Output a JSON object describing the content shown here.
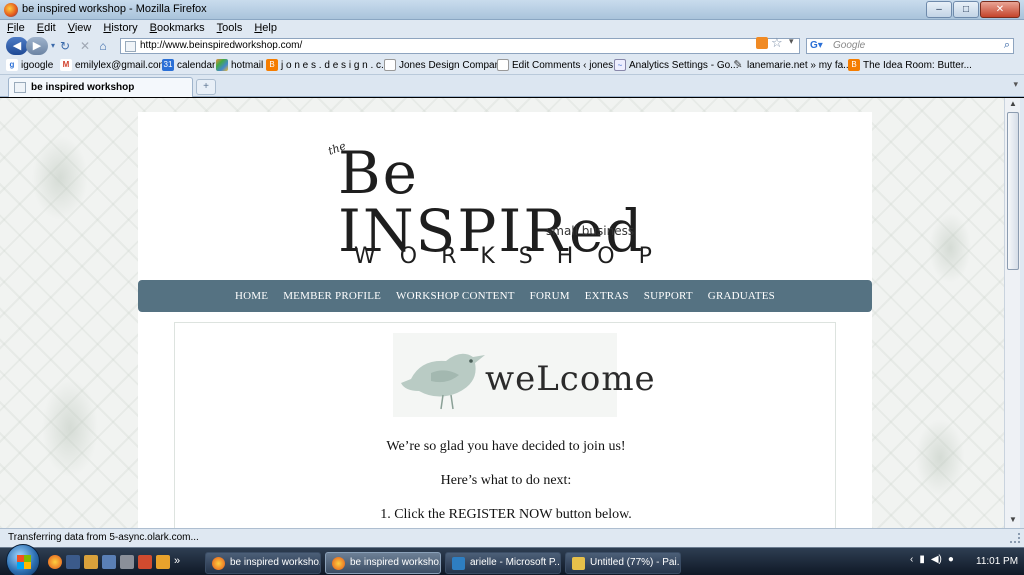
{
  "window": {
    "title": "be inspired workshop - Mozilla Firefox",
    "minimize_label": "–",
    "maximize_label": "□",
    "close_label": "✕"
  },
  "menu": [
    "File",
    "Edit",
    "View",
    "History",
    "Bookmarks",
    "Tools",
    "Help"
  ],
  "navigation": {
    "url": "http://www.beinspiredworkshop.com/",
    "search_placeholder": "Google"
  },
  "bookmarks": [
    {
      "label": "igoogle",
      "icon": "google-icon"
    },
    {
      "label": "emilylex@gmail.com",
      "icon": "gmail-icon"
    },
    {
      "label": "calendar",
      "icon": "calendar-icon",
      "badge": "31"
    },
    {
      "label": "hotmail",
      "icon": "msn-icon"
    },
    {
      "label": "j o n e s . d e s i g n . c...",
      "icon": "blogger-icon"
    },
    {
      "label": "Jones Design Company",
      "icon": "page-icon"
    },
    {
      "label": "Edit Comments ‹ jones...",
      "icon": "page-icon"
    },
    {
      "label": "Analytics Settings - Go...",
      "icon": "analytics-icon"
    },
    {
      "label": "lanemarie.net » my fa...",
      "icon": "lane-icon"
    },
    {
      "label": "The Idea Room: Butter...",
      "icon": "blogger-icon"
    }
  ],
  "tabs": [
    {
      "label": "be inspired workshop"
    }
  ],
  "site": {
    "logo": {
      "the": "the",
      "main": "Be INSPIRed",
      "tagline": "small business",
      "workshop": "WORKSHOP"
    },
    "nav": [
      "HOME",
      "MEMBER PROFILE",
      "WORKSHOP CONTENT",
      "FORUM",
      "EXTRAS",
      "SUPPORT",
      "GRADUATES"
    ],
    "welcome_word": "weLcome",
    "paragraphs": [
      "We’re so glad you have decided to join us!",
      "Here’s what to do next:",
      "1. Click the REGISTER NOW button below."
    ]
  },
  "status": "Transferring data from 5-async.olark.com...",
  "taskbar": {
    "buttons": [
      {
        "label": "be inspired worksho...",
        "icon": "firefox-icon"
      },
      {
        "label": "be inspired worksho...",
        "icon": "firefox-icon",
        "active": true
      },
      {
        "label": "arielle - Microsoft P...",
        "icon": "publisher-icon"
      },
      {
        "label": "Untitled (77%) - Pai...",
        "icon": "paint-icon"
      }
    ],
    "clock": "11:01 PM"
  }
}
